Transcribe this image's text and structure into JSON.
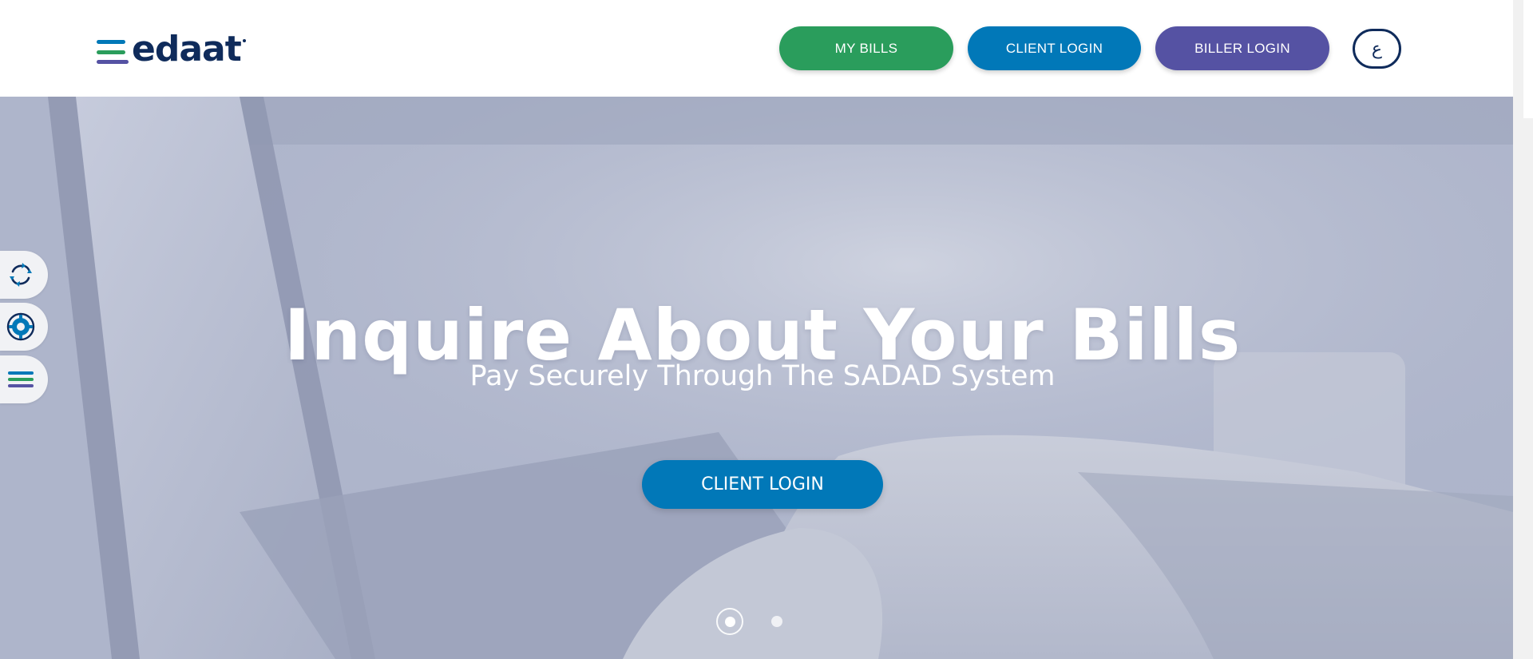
{
  "header": {
    "logo_text": "edaat",
    "nav": {
      "my_bills": "MY BILLS",
      "client_login": "CLIENT LOGIN",
      "biller_login": "BILLER LOGIN",
      "language": "ع"
    }
  },
  "hero": {
    "title": "Inquire About Your Bills",
    "subtitle": "Pay Securely Through The SADAD System",
    "cta": "CLIENT LOGIN",
    "slides": {
      "count": 2,
      "active": 1
    }
  },
  "side_widgets": [
    {
      "icon": "refresh-arrows-icon"
    },
    {
      "icon": "settings-gear-icon"
    },
    {
      "icon": "edaat-menu-icon"
    }
  ],
  "colors": {
    "navy": "#0f2b5b",
    "green": "#2a9d5c",
    "blue": "#0178b8",
    "purple": "#5552a3",
    "logo_blue": "#0178b8",
    "logo_green": "#2a9d5c",
    "logo_purple": "#5552a3"
  }
}
